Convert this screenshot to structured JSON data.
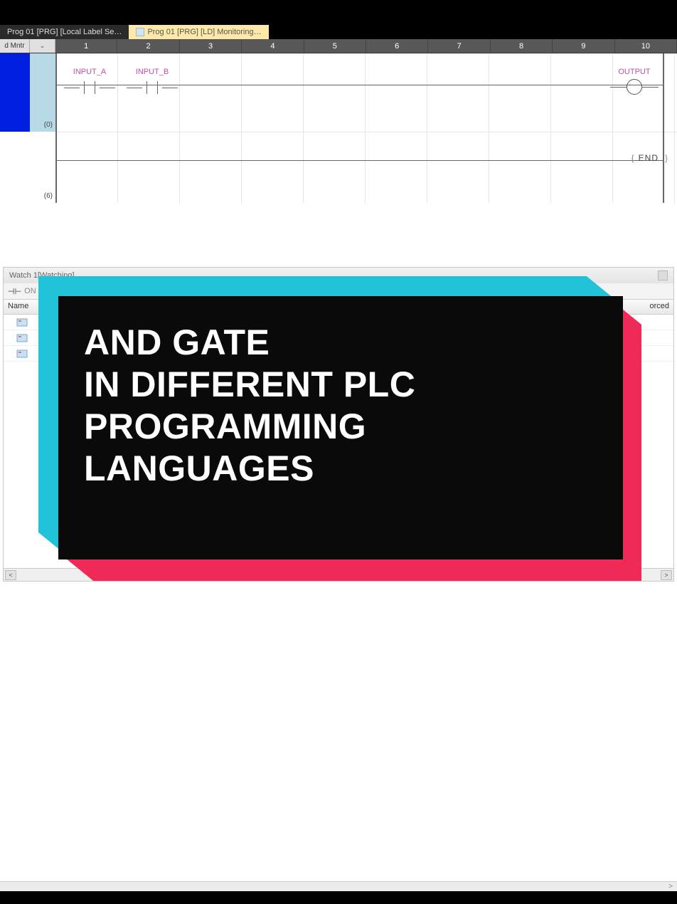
{
  "tabs": {
    "inactive_label": "Prog 01 [PRG] [Local Label Se…",
    "active_label": "Prog 01 [PRG] [LD] Monitoring…"
  },
  "ruler": {
    "mntr": "d Mntr",
    "chev": "⌄",
    "cols": [
      "1",
      "2",
      "3",
      "4",
      "5",
      "6",
      "7",
      "8",
      "9",
      "10"
    ]
  },
  "ladder": {
    "row0": "(0)",
    "row6": "(6)",
    "input_a": "INPUT_A",
    "input_b": "INPUT_B",
    "output": "OUTPUT",
    "end": "END"
  },
  "watch": {
    "title": "Watch 1[Watching]",
    "on_label": "ON",
    "name_col": "Name",
    "forced_col": "orced"
  },
  "overlay": {
    "headline": "AND GATE\nIN DIFFERENT PLC\nPROGRAMMING\nLANGUAGES"
  },
  "bottom": {
    "chev": ">"
  }
}
